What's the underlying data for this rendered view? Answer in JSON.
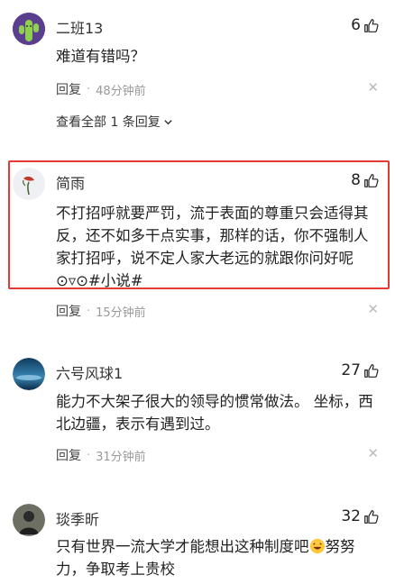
{
  "comments": [
    {
      "name": "二班13",
      "likes": "6",
      "text": "难道有错吗？",
      "reply_label": "回复",
      "time": "48分钟前",
      "view_all": "查看全部 1 条回复"
    },
    {
      "name": "简雨",
      "likes": "8",
      "text_lines": [
        "不打招呼就要严罚，流于表面的尊重只会适得其",
        "反，还不如多干点实事，那样的话，你不强制人",
        "家打招呼，说不定人家大老远的就跟你问好呢",
        "⊙▿⊙#小说#"
      ],
      "reply_label": "回复",
      "time": "15分钟前"
    },
    {
      "name": "六号风球1",
      "likes": "27",
      "text_lines": [
        "能力不大架子很大的领导的惯常做法。 坐标，西",
        "北边疆，表示有遇到过。"
      ],
      "reply_label": "回复",
      "time": "31分钟前"
    },
    {
      "name": "琰季昕",
      "likes": "32",
      "text_line1_a": "只有世界一流大学才能想出这种制度吧",
      "text_line1_b": "努努",
      "text_line2": "力，争取考上贵校"
    }
  ],
  "icons": {
    "like": "thumbs-up-icon",
    "close": "close-icon",
    "chevron": "chevron-down-icon"
  },
  "colors": {
    "highlight": "#e53935",
    "secondary_text": "#999999"
  }
}
